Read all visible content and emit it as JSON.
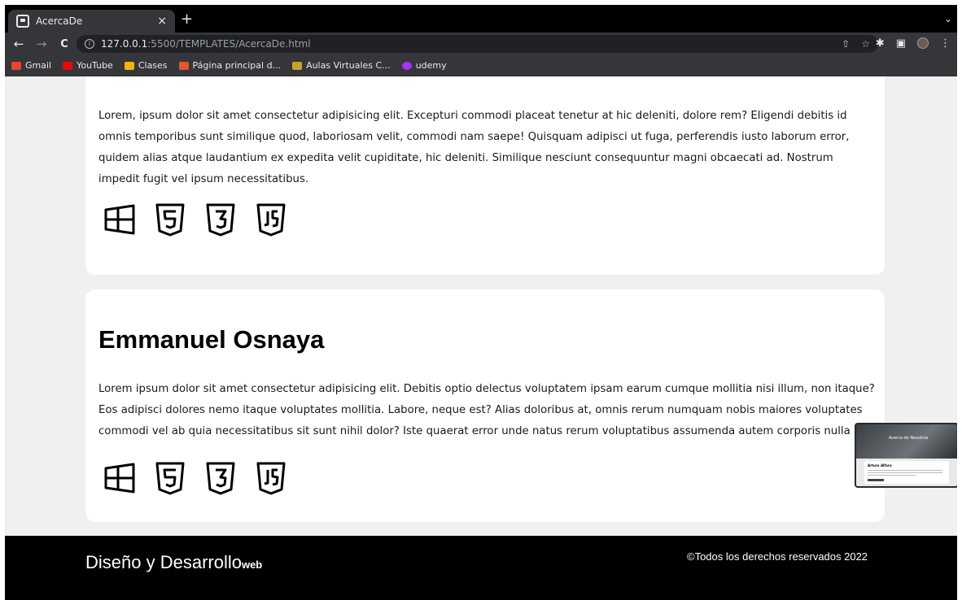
{
  "browser": {
    "tab_title": "AcercaDe",
    "tab_close": "×",
    "new_tab": "+",
    "tab_menu": "⌄",
    "url_host": "127.0.0.1",
    "url_path": ":5500/TEMPLATES/AcercaDe.html",
    "back": "←",
    "forward": "→",
    "reload": "C",
    "share_icon": "⇧",
    "star_icon": "☆",
    "ext_icon": "✱",
    "panel_icon": "▣",
    "menu_icon": "⋮"
  },
  "bookmarks": [
    {
      "label": "Gmail",
      "color": "#ea4335"
    },
    {
      "label": "YouTube",
      "color": "#ff0000"
    },
    {
      "label": "Clases",
      "color": "#f4b400"
    },
    {
      "label": "Página principal d...",
      "color": "#e8562a"
    },
    {
      "label": "Aulas Virtuales C...",
      "color": "#c9a227"
    },
    {
      "label": "udemy",
      "color": "#a435f0"
    }
  ],
  "cards": [
    {
      "paragraph": "Lorem, ipsum dolor sit amet consectetur adipisicing elit. Excepturi commodi placeat tenetur at hic deleniti, dolore rem? Eligendi debitis id omnis temporibus sunt similique quod, laboriosam velit, commodi nam saepe! Quisquam adipisci ut fuga, perferendis iusto laborum error, quidem alias atque laudantium ex expedita velit cupiditate, hic deleniti. Similique nesciunt consequuntur magni obcaecati ad. Nostrum impedit fugit vel ipsum necessitatibus."
    },
    {
      "name": "Emmanuel Osnaya",
      "paragraph": "Lorem ipsum dolor sit amet consectetur adipisicing elit. Debitis optio delectus voluptatem ipsam earum cumque mollitia nisi illum, non itaque? Eos adipisci dolores nemo itaque voluptates mollitia. Labore, neque est? Alias doloribus at, omnis rerum numquam nobis maiores voluptates commodi vel ab quia necessitatibus sit sunt nihil dolor? Iste quaerat error unde natus rerum voluptatibus assumenda autem corporis nulla ad."
    }
  ],
  "tech_icons": [
    "windows-icon",
    "html5-icon",
    "css3-icon",
    "javascript-icon"
  ],
  "footer": {
    "brand": "Diseño y Desarrollo",
    "brand_suffix": "web",
    "copyright": "©Todos los derechos reservados 2022"
  },
  "thumbnail": {
    "hero_text": "Acerca de Nosotros",
    "name": "Arturo Alfaro"
  }
}
